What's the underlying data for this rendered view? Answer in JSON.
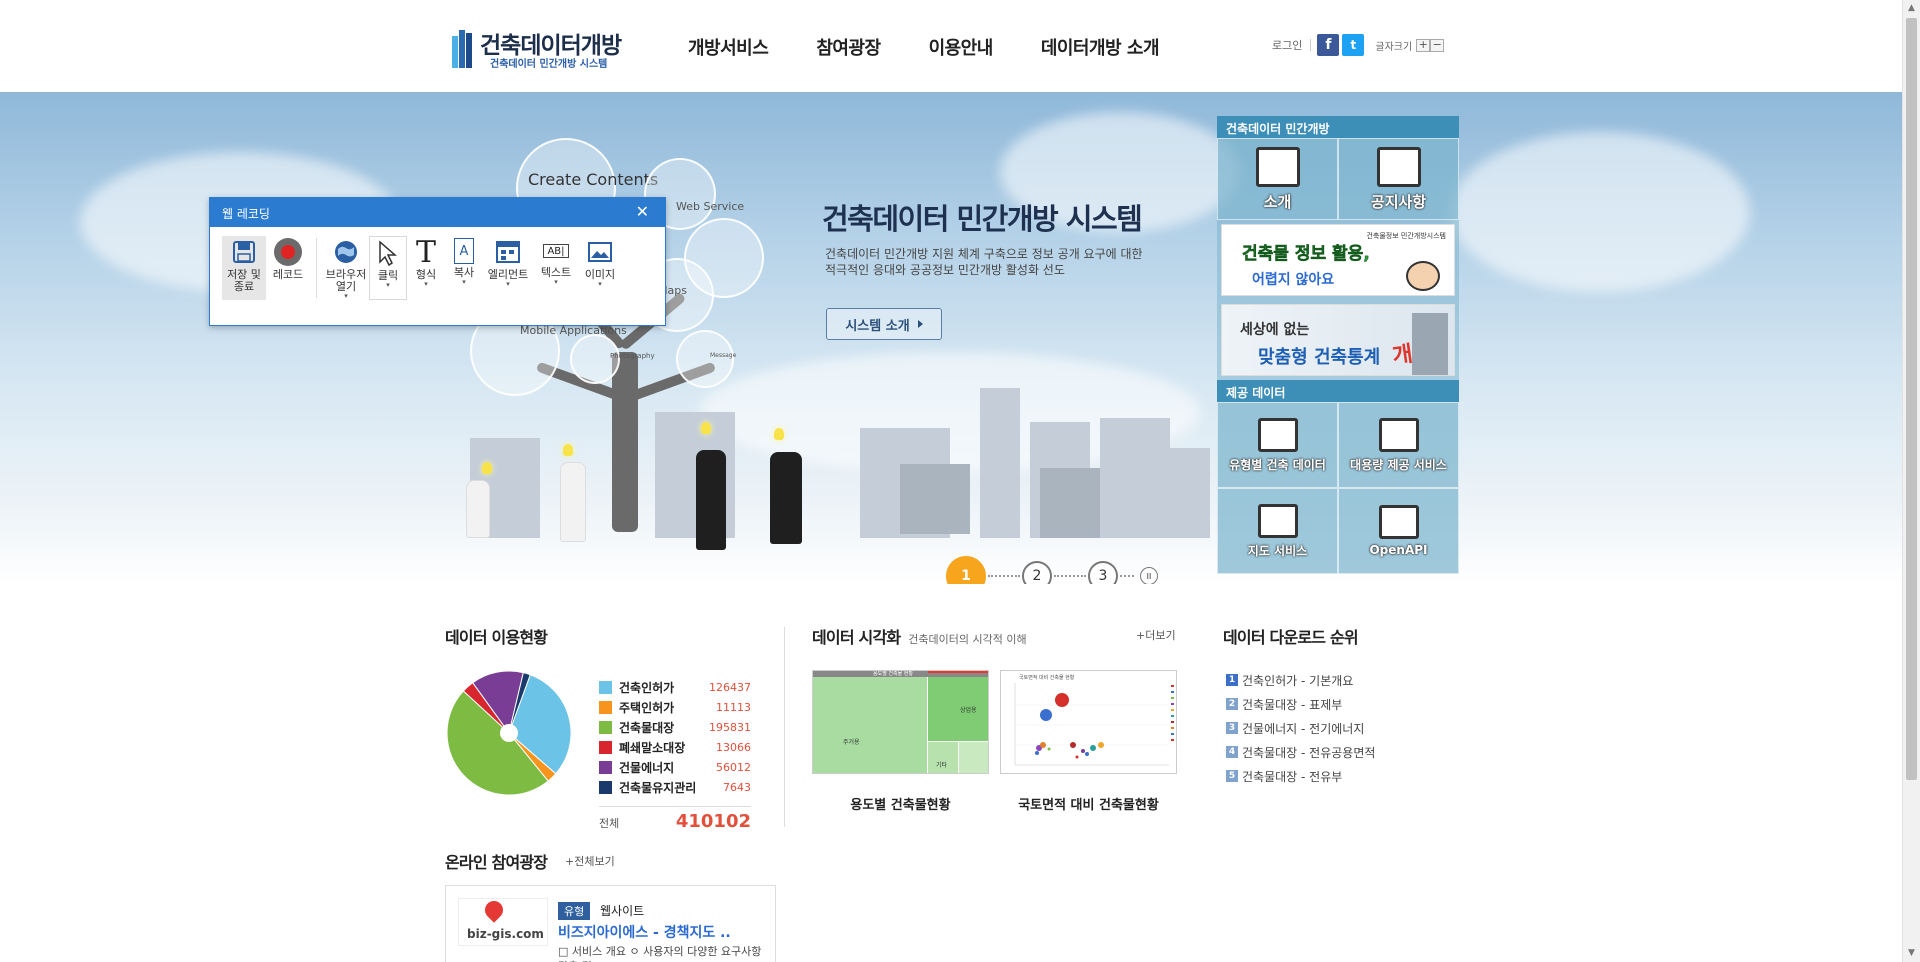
{
  "logo": {
    "title": "건축데이터개방",
    "subtitle": "건축데이터 민간개방 시스템"
  },
  "gnb": [
    "개방서비스",
    "참여광장",
    "이용안내",
    "데이터개방 소개"
  ],
  "util": {
    "login": "로그인",
    "font_size_label": "글자크기",
    "font_plus": "+",
    "font_minus": "−"
  },
  "hero": {
    "title": "건축데이터 민간개방 시스템",
    "desc": "건축데이터 민간개방 지원 체계 구축으로 정보 공개 요구에 대한 적극적인 응대와 공공정보 민간개방 활성화 선도",
    "button": "시스템 소개",
    "bubbles": {
      "create": "Create Contents",
      "web": "Web Service",
      "maps": "Maps",
      "mobile": "Mobile Applications",
      "photo": "Photography",
      "message": "Message"
    },
    "pager": [
      "1",
      "2",
      "3"
    ],
    "pause": "II"
  },
  "side": {
    "open_header": "건축데이터 민간개방",
    "tiles_top": [
      {
        "label": "소개",
        "icon": "building-icon"
      },
      {
        "label": "공지사항",
        "icon": "notice-icon"
      }
    ],
    "banner1": {
      "top": "건축물정보 민간개방시스템",
      "line1": "건축물 정보 활용,",
      "line2": "어렵지 않아요"
    },
    "banner2": {
      "line1": "세상에 없는",
      "line2": "맞춤형 건축통계",
      "line3": "개시!"
    },
    "data_header": "제공 데이터",
    "tiles_bottom": [
      {
        "label": "유형별 건축 데이터",
        "icon": "browser-icon"
      },
      {
        "label": "대용량 제공 서비스",
        "icon": "archive-icon"
      },
      {
        "label": "지도 서비스",
        "icon": "map-pin-icon"
      },
      {
        "label": "OpenAPI",
        "icon": "api-icon"
      }
    ]
  },
  "recorder": {
    "title": "웹 레코딩",
    "close": "✕",
    "tools": [
      {
        "label": "저장 및\n종료",
        "icon": "save-icon"
      },
      {
        "label": "레코드",
        "icon": "record-icon"
      },
      {
        "label": "브라우저\n열기",
        "icon": "globe-icon"
      },
      {
        "label": "클릭",
        "icon": "cursor-icon"
      },
      {
        "label": "형식",
        "icon": "text-format-icon"
      },
      {
        "label": "복사",
        "icon": "copy-icon"
      },
      {
        "label": "엘리먼트",
        "icon": "element-icon"
      },
      {
        "label": "텍스트",
        "icon": "text-field-icon"
      },
      {
        "label": "이미지",
        "icon": "image-icon"
      }
    ],
    "glyphs": {
      "text_format": "T",
      "copy": "A",
      "text_field": "AB|",
      "dropdown": "▾"
    }
  },
  "usage": {
    "title": "데이터 이용현황",
    "total_label": "전체",
    "total_value": "410102"
  },
  "chart_data": {
    "type": "pie",
    "title": "데이터 이용현황",
    "categories": [
      "건축인허가",
      "주택인허가",
      "건축물대장",
      "폐쇄말소대장",
      "건물에너지",
      "건축물유지관리"
    ],
    "values": [
      126437,
      11113,
      195831,
      13066,
      56012,
      7643
    ],
    "value_labels": [
      "126437",
      "11113",
      "195831",
      "13066",
      "56012",
      "7643"
    ],
    "colors": [
      "#6cc3e8",
      "#f7941d",
      "#7dbb42",
      "#d7262d",
      "#7a3d96",
      "#1a3a6b"
    ],
    "total": 410102
  },
  "viz": {
    "title": "데이터 시각화",
    "subtitle": "건축데이터의 시각적 이해",
    "more": "+더보기",
    "cards": [
      {
        "caption": "용도별 건축물현황",
        "thumb_title": "용도별 건축물 현황",
        "labels": [
          "주거용",
          "상업용",
          "기타"
        ]
      },
      {
        "caption": "국토면적 대비 건축물현황",
        "thumb_title": "국토면적 대비 건축물 현황"
      }
    ]
  },
  "rank": {
    "title": "데이터 다운로드 순위",
    "items": [
      {
        "no": "1",
        "label": "건축인허가 - 기본개요"
      },
      {
        "no": "2",
        "label": "건축물대장 - 표제부"
      },
      {
        "no": "3",
        "label": "건물에너지 - 전기에너지"
      },
      {
        "no": "4",
        "label": "건축물대장 - 전유공용면적"
      },
      {
        "no": "5",
        "label": "건축물대장 - 전유부"
      }
    ]
  },
  "online": {
    "title": "온라인 참여광장",
    "more": "+전체보기",
    "card": {
      "logo_text": "biz-gis.com",
      "tag": "유형",
      "type": "웹사이트",
      "name": "비즈지아이에스 - 경책지도 ..",
      "desc": "□ 서비스 개요 ㅇ 사용자의 다양한 요구사항 맞춤 및 ..."
    }
  },
  "scroll": {
    "up": "▲",
    "down": "▼"
  }
}
